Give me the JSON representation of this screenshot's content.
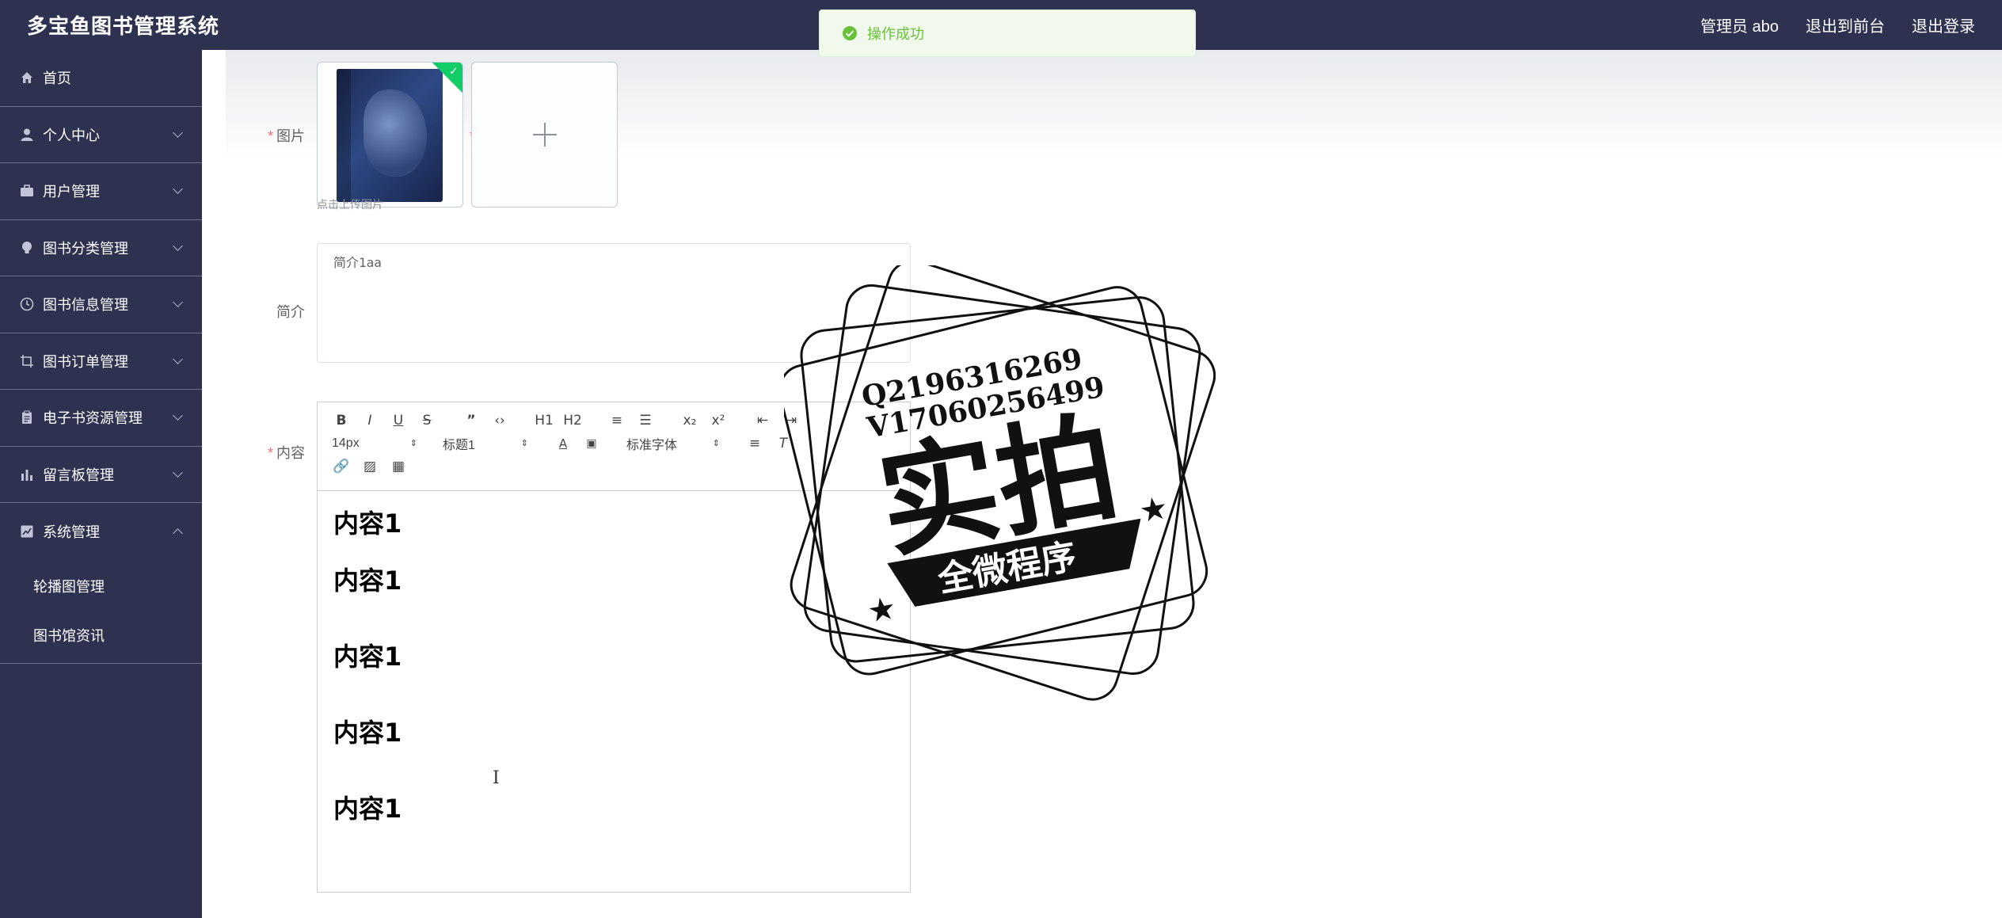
{
  "header": {
    "title": "多宝鱼图书管理系统",
    "links": [
      "管理员 abo",
      "退出到前台",
      "退出登录"
    ]
  },
  "sidebar": {
    "items": [
      {
        "label": "首页",
        "icon": "home-icon"
      },
      {
        "label": "个人中心",
        "icon": "user-icon"
      },
      {
        "label": "用户管理",
        "icon": "briefcase-icon"
      },
      {
        "label": "图书分类管理",
        "icon": "lightbulb-icon"
      },
      {
        "label": "图书信息管理",
        "icon": "clock-icon"
      },
      {
        "label": "图书订单管理",
        "icon": "crop-icon"
      },
      {
        "label": "电子书资源管理",
        "icon": "clipboard-icon"
      },
      {
        "label": "留言板管理",
        "icon": "bar-chart-icon"
      },
      {
        "label": "系统管理",
        "icon": "chart-icon"
      }
    ],
    "sub_items": [
      "轮播图管理",
      "图书馆资讯"
    ]
  },
  "toast": {
    "message": "操作成功"
  },
  "form": {
    "image_label": "图片",
    "upload_hint": "点击上传图片",
    "intro_label": "简介",
    "intro_value": "简介1aa",
    "content_label": "内容"
  },
  "editor": {
    "toolbar_row1": [
      "B",
      "I",
      "U",
      "S",
      "”",
      "‹›",
      "H1",
      "H2",
      "≡",
      "☰",
      "x₂",
      "x²",
      "⇤",
      "⇥"
    ],
    "font_size": "14px",
    "heading": "标题1",
    "font_family": "标准字体",
    "content_lines": [
      "内容1",
      "内容1",
      "内容1",
      "内容1",
      "内容1"
    ]
  },
  "watermark": {
    "lines": [
      "Q2196316269",
      "V17060256499"
    ],
    "big_text": "实拍",
    "ribbon": "全微程序"
  }
}
